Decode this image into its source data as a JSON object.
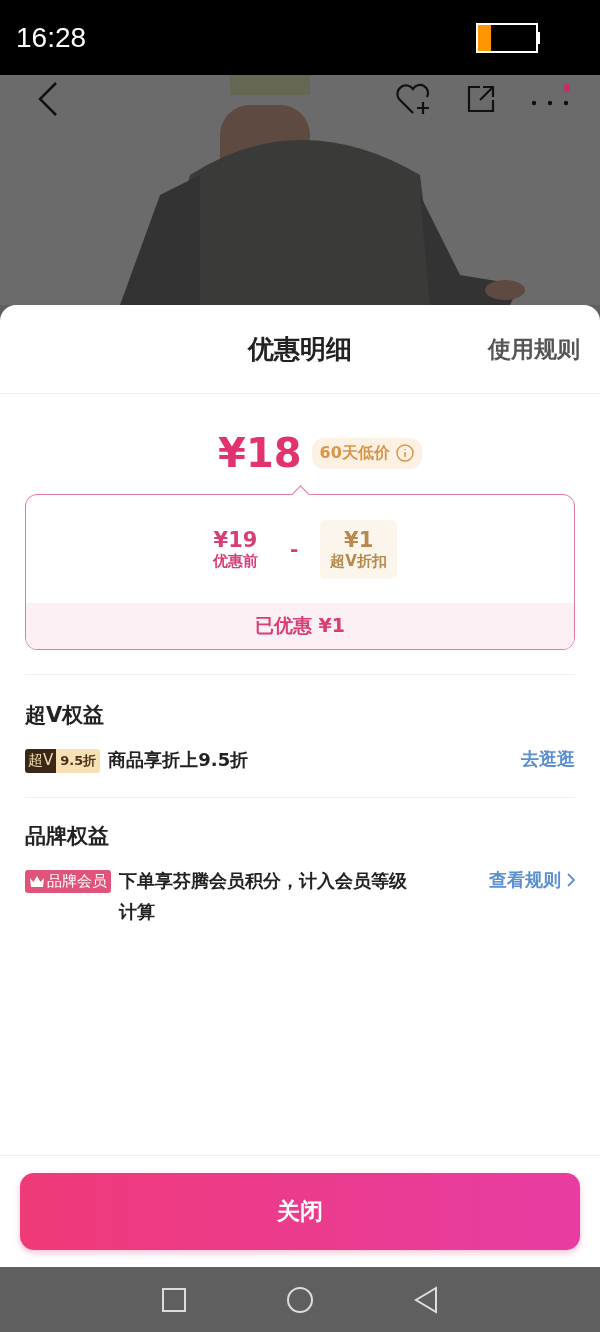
{
  "status_bar": {
    "time": "16:28"
  },
  "sheet": {
    "title": "优惠明细",
    "rules_link": "使用规则"
  },
  "price": {
    "final": "¥18",
    "badge": "60天低价"
  },
  "breakdown": {
    "items": [
      {
        "kind": "original",
        "amount": "¥19",
        "label": "优惠前"
      },
      {
        "kind": "discount",
        "amount": "¥1",
        "label": "超V折扣"
      }
    ],
    "operator": "-",
    "saved": "已优惠 ¥1"
  },
  "sections": [
    {
      "title": "超V权益",
      "benefits": [
        {
          "kind": "super_v",
          "tag": "超V",
          "tag_value": "9.5折",
          "text": "商品享折上9.5折",
          "action": "去逛逛",
          "chevron": false
        }
      ]
    },
    {
      "title": "品牌权益",
      "benefits": [
        {
          "kind": "brand",
          "tag": "品牌会员",
          "text": "下单享芬腾会员积分，计入会员等级计算",
          "action": "查看规则",
          "chevron": true
        }
      ]
    }
  ],
  "close_button": "关闭"
}
